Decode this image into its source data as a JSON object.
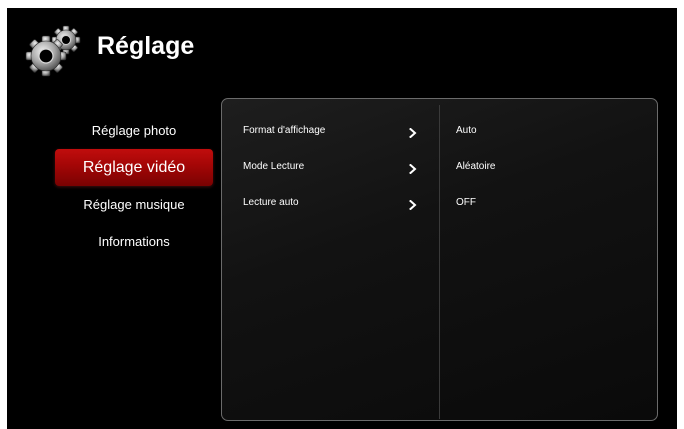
{
  "header": {
    "title": "Réglage",
    "icon": "gear-icon"
  },
  "menu": {
    "items": [
      {
        "label": "Réglage photo",
        "active": false
      },
      {
        "label": "Réglage vidéo",
        "active": true
      },
      {
        "label": "Réglage musique",
        "active": false
      },
      {
        "label": "Informations",
        "active": false
      }
    ]
  },
  "settings": [
    {
      "label": "Format d'affichage",
      "value": "Auto",
      "icon": "chevron-right-icon"
    },
    {
      "label": "Mode Lecture",
      "value": "Aléatoire",
      "icon": "chevron-right-icon"
    },
    {
      "label": "Lecture auto",
      "value": "OFF",
      "icon": "chevron-right-icon"
    }
  ],
  "colors": {
    "accent": "#a30606",
    "background": "#000000",
    "panel_border": "#6b6b6b",
    "text": "#ffffff"
  }
}
